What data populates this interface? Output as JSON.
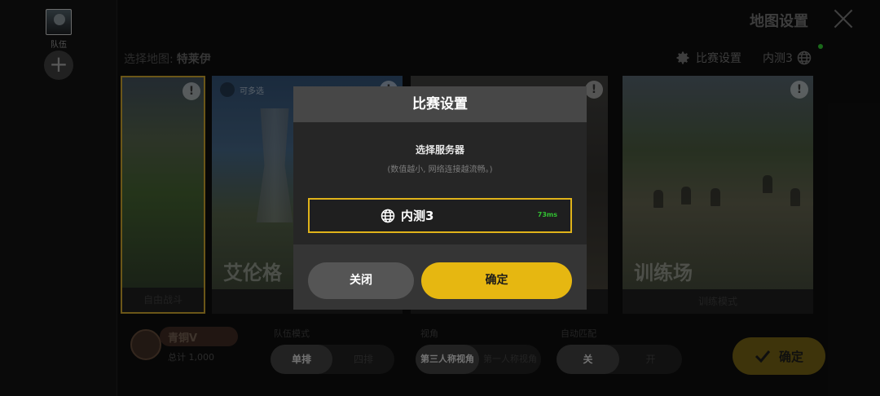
{
  "team": {
    "label": "队伍",
    "add_symbol": "+"
  },
  "header": {
    "title": "地图设置"
  },
  "map_select": {
    "label": "选择地图:",
    "map_name": "特莱伊"
  },
  "top_right": {
    "match_settings_label": "比赛设置",
    "server_label": "内测3"
  },
  "cards": [
    {
      "footer": "自由战斗",
      "big_label": ""
    },
    {
      "footer": "",
      "big_label": "艾伦格",
      "tag": "可多选"
    },
    {
      "footer": "",
      "big_label": ""
    },
    {
      "footer": "训练模式",
      "big_label": "训练场"
    }
  ],
  "bottom": {
    "rank_name": "青铜V",
    "rank_total": "总计 1,000",
    "team_mode": {
      "label": "队伍模式",
      "options": [
        "单排",
        "四排"
      ],
      "selected": "单排"
    },
    "view": {
      "label": "视角",
      "options": [
        "第三人称视角",
        "第一人称视角"
      ],
      "selected": "第三人称视角"
    },
    "auto_match": {
      "label": "自动匹配",
      "options": [
        "关",
        "开"
      ],
      "selected": "关"
    },
    "confirm_label": "确定"
  },
  "dialog": {
    "title": "比赛设置",
    "subtitle": "选择服务器",
    "hint": "(数值越小, 网络连接越流畅。)",
    "server": {
      "name": "内测3",
      "ping": "73ms"
    },
    "close_label": "关闭",
    "ok_label": "确定"
  },
  "colors": {
    "accent": "#e6b711",
    "ping_green": "#32c232",
    "dialog_bg": "#353535"
  },
  "icons": [
    "close-icon",
    "gear-icon",
    "globe-icon",
    "check-icon",
    "add-icon"
  ]
}
